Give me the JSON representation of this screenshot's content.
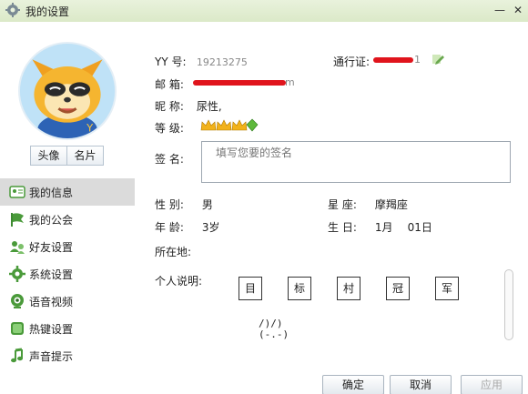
{
  "window": {
    "title": "我的设置"
  },
  "profile": {
    "photo_btn": "头像",
    "card_btn": "名片",
    "yy_label": "YY 号:",
    "yy_value": "19213275",
    "pass_label": "通行证:",
    "pass_value_suffix": "1",
    "email_label": "邮 箱:",
    "email_suffix": "m",
    "nick_label": "昵 称:",
    "nick_value": "尿性,",
    "level_label": "等 级:",
    "sign_label": "签 名:",
    "sign_placeholder": "填写您要的签名",
    "gender_label": "性 别:",
    "gender_value": "男",
    "zodiac_label": "星 座:",
    "zodiac_value": "摩羯座",
    "age_label": "年 龄:",
    "age_value": "3岁",
    "birthday_label": "生 日:",
    "birth_month": "1月",
    "birth_day": "01日",
    "location_label": "所在地:",
    "note_label": "个人说明:",
    "note_chars": [
      "目",
      "标",
      "村",
      "冠",
      "军"
    ],
    "kaomoji_line1": "/)/)",
    "kaomoji_line2": "(-.-)"
  },
  "nav": {
    "items": [
      {
        "label": "我的信息",
        "icon": "profile-card-icon",
        "active": true
      },
      {
        "label": "我的公会",
        "icon": "flag-icon",
        "active": false
      },
      {
        "label": "好友设置",
        "icon": "friends-icon",
        "active": false
      },
      {
        "label": "系统设置",
        "icon": "gear-icon",
        "active": false
      },
      {
        "label": "语音视频",
        "icon": "webcam-icon",
        "active": false
      },
      {
        "label": "热键设置",
        "icon": "hotkey-icon",
        "active": false
      },
      {
        "label": "声音提示",
        "icon": "music-note-icon",
        "active": false
      }
    ]
  },
  "buttons": {
    "ok": "确定",
    "cancel": "取消",
    "apply": "应用"
  },
  "colors": {
    "accent_green": "#6aa84f",
    "redaction": "#e0141c",
    "crown": "#f2b21a"
  }
}
